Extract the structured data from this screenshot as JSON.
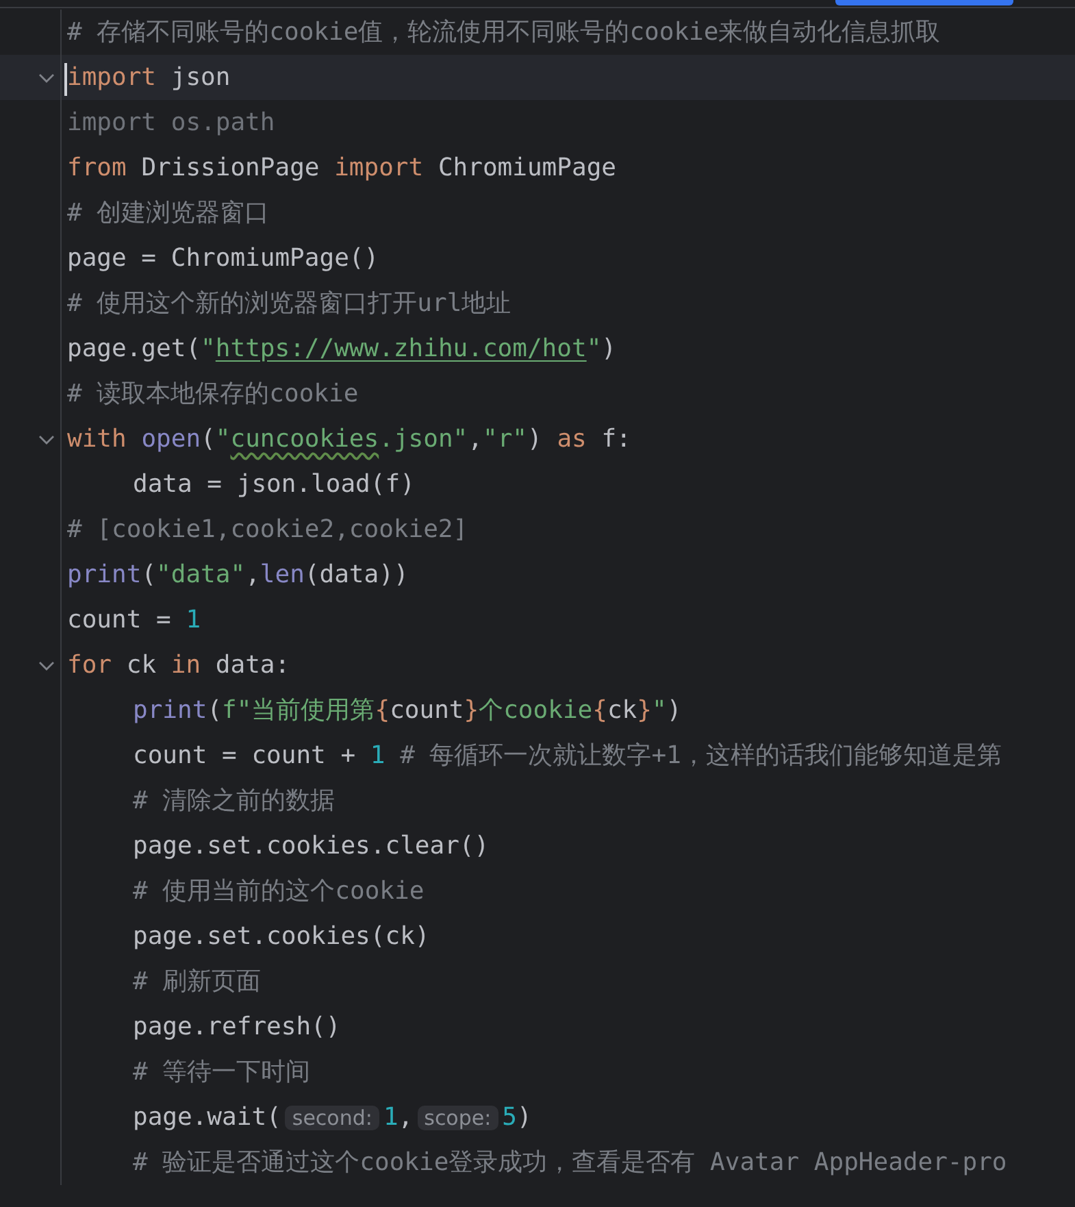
{
  "editor": {
    "lines": [
      {
        "fold": false,
        "current": false,
        "tokens": [
          {
            "kind": "comment",
            "text": "# 存储不同账号的cookie值，轮流使用不同账号的cookie来做自动化信息抓取"
          }
        ]
      },
      {
        "fold": true,
        "current": true,
        "tokens": [
          {
            "kind": "keyword",
            "text": "import"
          },
          {
            "kind": "plain",
            "text": " json"
          }
        ]
      },
      {
        "fold": false,
        "current": false,
        "tokens": [
          {
            "kind": "unused",
            "text": "import os.path"
          }
        ]
      },
      {
        "fold": false,
        "current": false,
        "tokens": [
          {
            "kind": "keyword",
            "text": "from"
          },
          {
            "kind": "plain",
            "text": " DrissionPage "
          },
          {
            "kind": "keyword",
            "text": "import"
          },
          {
            "kind": "plain",
            "text": " ChromiumPage"
          }
        ]
      },
      {
        "fold": false,
        "current": false,
        "tokens": [
          {
            "kind": "comment",
            "text": "# 创建浏览器窗口"
          }
        ]
      },
      {
        "fold": false,
        "current": false,
        "tokens": [
          {
            "kind": "plain",
            "text": "page = ChromiumPage()"
          }
        ]
      },
      {
        "fold": false,
        "current": false,
        "tokens": [
          {
            "kind": "comment",
            "text": "# 使用这个新的浏览器窗口打开url地址"
          }
        ]
      },
      {
        "fold": false,
        "current": false,
        "tokens": [
          {
            "kind": "plain",
            "text": "page.get("
          },
          {
            "kind": "string",
            "text": "\""
          },
          {
            "kind": "url",
            "text": "https://www.zhihu.com/hot"
          },
          {
            "kind": "string",
            "text": "\""
          },
          {
            "kind": "plain",
            "text": ")"
          }
        ]
      },
      {
        "fold": false,
        "current": false,
        "tokens": [
          {
            "kind": "comment",
            "text": "# 读取本地保存的cookie"
          }
        ]
      },
      {
        "fold": true,
        "current": false,
        "tokens": [
          {
            "kind": "keyword",
            "text": "with"
          },
          {
            "kind": "builtin",
            "text": " open"
          },
          {
            "kind": "plain",
            "text": "("
          },
          {
            "kind": "string",
            "text": "\""
          },
          {
            "kind": "typo",
            "text": "cuncookies"
          },
          {
            "kind": "string",
            "text": ".json\""
          },
          {
            "kind": "plain",
            "text": ","
          },
          {
            "kind": "string",
            "text": "\"r\""
          },
          {
            "kind": "plain",
            "text": ") "
          },
          {
            "kind": "keyword",
            "text": "as"
          },
          {
            "kind": "plain",
            "text": " f:"
          }
        ],
        "children": [
          {
            "fold": false,
            "current": false,
            "tokens": [
              {
                "kind": "plain",
                "text": "data = json.load(f)"
              }
            ]
          }
        ]
      },
      {
        "fold": false,
        "current": false,
        "tokens": [
          {
            "kind": "comment",
            "text": "# [cookie1,cookie2,cookie2]"
          }
        ]
      },
      {
        "fold": false,
        "current": false,
        "tokens": [
          {
            "kind": "builtin",
            "text": "print"
          },
          {
            "kind": "plain",
            "text": "("
          },
          {
            "kind": "string",
            "text": "\"data\""
          },
          {
            "kind": "plain",
            "text": ","
          },
          {
            "kind": "builtin",
            "text": "len"
          },
          {
            "kind": "plain",
            "text": "(data))"
          }
        ]
      },
      {
        "fold": false,
        "current": false,
        "tokens": [
          {
            "kind": "plain",
            "text": "count = "
          },
          {
            "kind": "number",
            "text": "1"
          }
        ]
      },
      {
        "fold": true,
        "current": false,
        "tokens": [
          {
            "kind": "keyword",
            "text": "for"
          },
          {
            "kind": "plain",
            "text": " ck "
          },
          {
            "kind": "keyword",
            "text": "in"
          },
          {
            "kind": "plain",
            "text": " data:"
          }
        ],
        "children": [
          {
            "fold": false,
            "current": false,
            "tokens": [
              {
                "kind": "builtin",
                "text": "print"
              },
              {
                "kind": "plain",
                "text": "("
              },
              {
                "kind": "string",
                "text": "f\"当前使用第"
              },
              {
                "kind": "brace",
                "text": "{"
              },
              {
                "kind": "plain",
                "text": "count"
              },
              {
                "kind": "brace",
                "text": "}"
              },
              {
                "kind": "string",
                "text": "个cookie"
              },
              {
                "kind": "brace",
                "text": "{"
              },
              {
                "kind": "plain",
                "text": "ck"
              },
              {
                "kind": "brace",
                "text": "}"
              },
              {
                "kind": "string",
                "text": "\""
              },
              {
                "kind": "plain",
                "text": ")"
              }
            ]
          },
          {
            "fold": false,
            "current": false,
            "tokens": [
              {
                "kind": "plain",
                "text": "count = count + "
              },
              {
                "kind": "number",
                "text": "1"
              },
              {
                "kind": "comment",
                "text": " # 每循环一次就让数字+1，这样的话我们能够知道是第"
              }
            ]
          },
          {
            "fold": false,
            "current": false,
            "tokens": [
              {
                "kind": "comment",
                "text": "# 清除之前的数据"
              }
            ]
          },
          {
            "fold": false,
            "current": false,
            "tokens": [
              {
                "kind": "plain",
                "text": "page.set.cookies.clear()"
              }
            ]
          },
          {
            "fold": false,
            "current": false,
            "tokens": [
              {
                "kind": "comment",
                "text": "# 使用当前的这个cookie"
              }
            ]
          },
          {
            "fold": false,
            "current": false,
            "tokens": [
              {
                "kind": "plain",
                "text": "page.set.cookies(ck)"
              }
            ]
          },
          {
            "fold": false,
            "current": false,
            "tokens": [
              {
                "kind": "comment",
                "text": "# 刷新页面"
              }
            ]
          },
          {
            "fold": false,
            "current": false,
            "tokens": [
              {
                "kind": "plain",
                "text": "page.refresh()"
              }
            ]
          },
          {
            "fold": false,
            "current": false,
            "tokens": [
              {
                "kind": "comment",
                "text": "# 等待一下时间"
              }
            ]
          },
          {
            "fold": false,
            "current": false,
            "tokens": [
              {
                "kind": "plain",
                "text": "page.wait("
              },
              {
                "kind": "hint",
                "text": "second:"
              },
              {
                "kind": "number",
                "text": "1"
              },
              {
                "kind": "plain",
                "text": ","
              },
              {
                "kind": "hint",
                "text": "scope:"
              },
              {
                "kind": "number",
                "text": "5"
              },
              {
                "kind": "plain",
                "text": ")"
              }
            ]
          },
          {
            "fold": false,
            "current": false,
            "tokens": [
              {
                "kind": "comment",
                "text": "# 验证是否通过这个cookie登录成功，查看是否有 Avatar AppHeader-pro"
              }
            ]
          }
        ]
      }
    ]
  }
}
